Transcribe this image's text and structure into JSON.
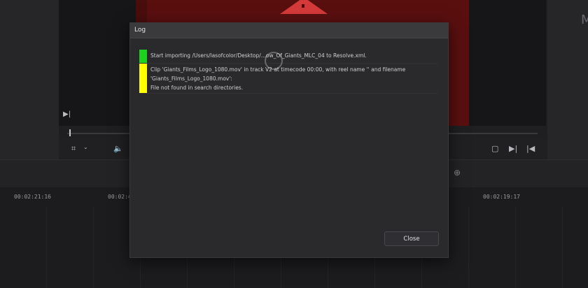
{
  "dialog": {
    "title": "Log",
    "close_label": "Close",
    "entries": [
      {
        "status_color": "#1fd11f",
        "text": "Start importing /Users/lasofcolor/Desktop/...ow_Of_Giants_MLC_04 to Resolve.xml."
      },
      {
        "status_color": "#ffff00",
        "text": "Clip 'Giants_Films_Logo_1080.mov' in track V2 at timecode 00:00, with reel name '' and filename\n'Giants_Films_Logo_1080.mov':\nFile not found in search directories."
      }
    ]
  },
  "viewer": {
    "warning_icon": "warning-triangle-icon",
    "accent_color": "#d43a3a"
  },
  "right_panel": {
    "label": "M"
  },
  "timeline": {
    "timecodes": [
      "00:02:21:16",
      "00:02:4",
      "00:02:19:17"
    ]
  }
}
